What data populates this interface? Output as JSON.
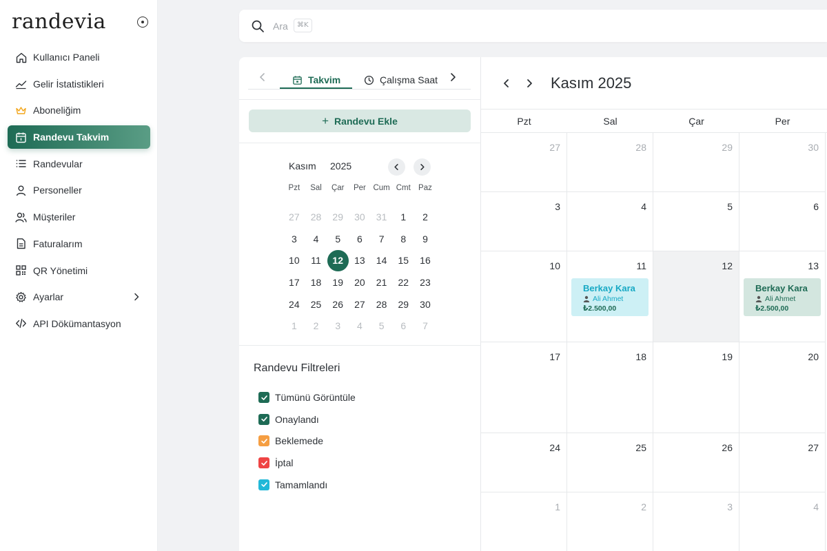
{
  "app": {
    "logo": "randevia"
  },
  "sidebar": {
    "items": [
      {
        "label": "Kullanıcı Paneli",
        "icon": "home-icon",
        "active": false
      },
      {
        "label": "Gelir İstatistikleri",
        "icon": "trend-chart-icon",
        "active": false
      },
      {
        "label": "Aboneliğim",
        "icon": "crown-icon",
        "active": false
      },
      {
        "label": "Randevu Takvim",
        "icon": "calendar-icon",
        "active": true
      },
      {
        "label": "Randevular",
        "icon": "list-icon",
        "active": false
      },
      {
        "label": "Personeller",
        "icon": "user-icon",
        "active": false
      },
      {
        "label": "Müşteriler",
        "icon": "users-icon",
        "active": false
      },
      {
        "label": "Faturalarım",
        "icon": "document-icon",
        "active": false
      },
      {
        "label": "QR Yönetimi",
        "icon": "qr-code-icon",
        "active": false
      },
      {
        "label": "Ayarlar",
        "icon": "gear-icon",
        "active": false,
        "has_submenu": true
      },
      {
        "label": "API Dökümantasyon",
        "icon": "code-icon",
        "active": false
      }
    ]
  },
  "search": {
    "placeholder": "Ara",
    "shortcut": "⌘K"
  },
  "tabs": [
    {
      "label": "Takvim",
      "icon": "calendar-icon",
      "active": true
    },
    {
      "label": "Çalışma Saat",
      "icon": "clock-icon",
      "active": false
    }
  ],
  "add_button": {
    "label": "Randevu Ekle"
  },
  "mini_calendar": {
    "month": "Kasım",
    "year": "2025",
    "weekdays": [
      "Pzt",
      "Sal",
      "Çar",
      "Per",
      "Cum",
      "Cmt",
      "Paz"
    ],
    "days": [
      {
        "d": "27",
        "out": true
      },
      {
        "d": "28",
        "out": true
      },
      {
        "d": "29",
        "out": true
      },
      {
        "d": "30",
        "out": true
      },
      {
        "d": "31",
        "out": true
      },
      {
        "d": "1"
      },
      {
        "d": "2"
      },
      {
        "d": "3"
      },
      {
        "d": "4"
      },
      {
        "d": "5"
      },
      {
        "d": "6"
      },
      {
        "d": "7"
      },
      {
        "d": "8"
      },
      {
        "d": "9"
      },
      {
        "d": "10"
      },
      {
        "d": "11"
      },
      {
        "d": "12",
        "today": true
      },
      {
        "d": "13"
      },
      {
        "d": "14"
      },
      {
        "d": "15"
      },
      {
        "d": "16"
      },
      {
        "d": "17"
      },
      {
        "d": "18"
      },
      {
        "d": "19"
      },
      {
        "d": "20"
      },
      {
        "d": "21"
      },
      {
        "d": "22"
      },
      {
        "d": "23"
      },
      {
        "d": "24"
      },
      {
        "d": "25"
      },
      {
        "d": "26"
      },
      {
        "d": "27"
      },
      {
        "d": "28"
      },
      {
        "d": "29"
      },
      {
        "d": "30"
      },
      {
        "d": "1",
        "out": true
      },
      {
        "d": "2",
        "out": true
      },
      {
        "d": "3",
        "out": true
      },
      {
        "d": "4",
        "out": true
      },
      {
        "d": "5",
        "out": true
      },
      {
        "d": "6",
        "out": true
      },
      {
        "d": "7",
        "out": true
      }
    ]
  },
  "filters": {
    "title": "Randevu Filtreleri",
    "items": [
      {
        "label": "Tümünü Görüntüle",
        "checked": true,
        "color": "#1e6b55"
      },
      {
        "label": "Onaylandı",
        "checked": true,
        "color": "#1e6b55"
      },
      {
        "label": "Beklemede",
        "checked": true,
        "color": "#f59e42"
      },
      {
        "label": "İptal",
        "checked": true,
        "color": "#ef4444"
      },
      {
        "label": "Tamamlandı",
        "checked": true,
        "color": "#22b8d8"
      }
    ]
  },
  "calendar": {
    "title": "Kasım 2025",
    "weekdays": [
      "Pzt",
      "Sal",
      "Çar",
      "Per"
    ],
    "weeks": [
      [
        {
          "d": "27",
          "out": true
        },
        {
          "d": "28",
          "out": true
        },
        {
          "d": "29",
          "out": true
        },
        {
          "d": "30",
          "out": true
        }
      ],
      [
        {
          "d": "3"
        },
        {
          "d": "4"
        },
        {
          "d": "5"
        },
        {
          "d": "6"
        }
      ],
      [
        {
          "d": "10"
        },
        {
          "d": "11",
          "appt": 0
        },
        {
          "d": "12",
          "today": true
        },
        {
          "d": "13",
          "appt": 1
        }
      ],
      [
        {
          "d": "17"
        },
        {
          "d": "18"
        },
        {
          "d": "19"
        },
        {
          "d": "20"
        }
      ],
      [
        {
          "d": "24"
        },
        {
          "d": "25"
        },
        {
          "d": "26"
        },
        {
          "d": "27"
        }
      ],
      [
        {
          "d": "1",
          "out": true
        },
        {
          "d": "2",
          "out": true
        },
        {
          "d": "3",
          "out": true
        },
        {
          "d": "4",
          "out": true
        }
      ]
    ],
    "appointments": [
      {
        "customer": "Berkay Kara",
        "staff": "Ali Ahmet",
        "amount": "₺2.500,00",
        "bg": "#cdf0f5",
        "name_color": "#17a9c4",
        "staff_color": "#17a9c4"
      },
      {
        "customer": "Berkay Kara",
        "staff": "Ali Ahmet",
        "amount": "₺2.500,00",
        "bg": "#d3e6df",
        "name_color": "#1e6b55",
        "staff_color": "#1e6b55"
      }
    ]
  }
}
